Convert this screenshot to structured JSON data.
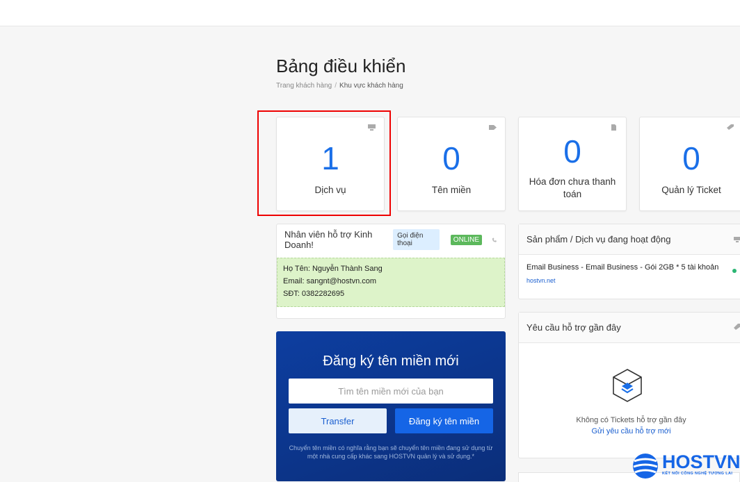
{
  "header": {
    "title": "Bảng điều khiển",
    "breadcrumb": {
      "home": "Trang khách hàng",
      "separator": "/",
      "current": "Khu vực khách hàng"
    }
  },
  "stats": [
    {
      "value": "1",
      "label": "Dịch vụ",
      "icon": "monitor-icon"
    },
    {
      "value": "0",
      "label": "Tên miền",
      "icon": "tag-icon"
    },
    {
      "value": "0",
      "label": "Hóa đơn chưa thanh toán",
      "icon": "document-icon"
    },
    {
      "value": "0",
      "label": "Quản lý Ticket",
      "icon": "ticket-icon"
    }
  ],
  "support": {
    "title": "Nhân viên hỗ trợ Kinh Doanh!",
    "call_label": "Gọi điện thoại",
    "status": "ONLINE",
    "name_line": "Họ Tên: Nguyễn Thành Sang",
    "email_line": "Email: sangnt@hostvn.com",
    "phone_line": "SĐT: 0382282695"
  },
  "domain_register": {
    "title": "Đăng ký tên miền mới",
    "placeholder": "Tìm tên miền mới của bạn",
    "transfer_label": "Transfer",
    "register_label": "Đăng ký tên miền",
    "note": "Chuyển tên miền có nghĩa rằng bạn sẽ chuyển tên miền đang sử dụng từ một nhà cung cấp khác sang HOSTVN quản lý và sử dụng.*"
  },
  "active_services": {
    "title": "Sản phẩm / Dịch vụ đang hoạt động",
    "items": [
      {
        "name": "Email Business - Email Business - Gói 2GB * 5 tài khoản",
        "domain": "hostvn.net",
        "status_color": "#2bb673"
      }
    ]
  },
  "recent_tickets": {
    "title": "Yêu cầu hỗ trợ gần đây",
    "empty_text": "Không có Tickets hỗ trợ gần đây",
    "link_text": "Gửi yêu cầu hỗ trợ mới"
  },
  "logo": {
    "name": "HOSTVN",
    "tagline": "KẾT NỐI CÔNG NGHỆ TƯƠNG LAI"
  },
  "colors": {
    "accent": "#1a6fe8",
    "online": "#5cb85c",
    "banner": "#0d3ea0",
    "highlight": "#ee0000"
  }
}
